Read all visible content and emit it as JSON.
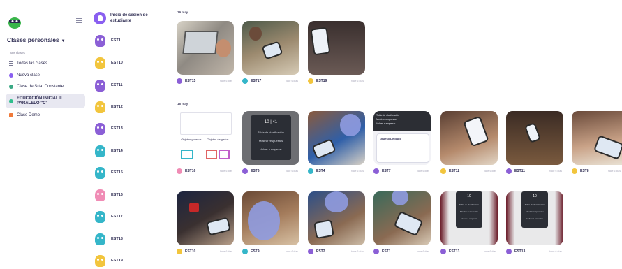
{
  "sidebar": {
    "class_title": "Clases personales",
    "section_label": "Sus clases",
    "items": [
      {
        "label": "Todas las clases",
        "icon": "list-icon",
        "color": "#7b7b95"
      },
      {
        "label": "Nueva clase",
        "icon": "plus-circle-icon",
        "color": "#8a5ff0"
      },
      {
        "label": "Clase de Srta. Constante",
        "icon": "class-dot-icon",
        "color": "#3aa884"
      },
      {
        "label": "EDUCACIÓN INICIAL II PARALELO \"C\"",
        "icon": "class-dot-icon",
        "color": "#2fbf8d"
      },
      {
        "label": "Clase Demo",
        "icon": "demo-icon",
        "color": "#f07a3b"
      }
    ]
  },
  "students": {
    "login_label": "Inicio de sesión de estudiante",
    "list": [
      {
        "name": "EST1",
        "color": "#8b5fd6"
      },
      {
        "name": "EST10",
        "color": "#f2c53d"
      },
      {
        "name": "EST11",
        "color": "#8b5fd6"
      },
      {
        "name": "EST12",
        "color": "#f2c53d"
      },
      {
        "name": "EST13",
        "color": "#8b5fd6"
      },
      {
        "name": "EST14",
        "color": "#35b6c9"
      },
      {
        "name": "EST15",
        "color": "#35b6c9"
      },
      {
        "name": "EST16",
        "color": "#f08cb5"
      },
      {
        "name": "EST17",
        "color": "#35b6c9"
      },
      {
        "name": "EST18",
        "color": "#35b6c9"
      },
      {
        "name": "EST19",
        "color": "#f2c53d"
      }
    ]
  },
  "feed": {
    "date1": "19 may",
    "date2": "18 may",
    "posts_row1": [
      {
        "student": "EST15",
        "time": "hace 6 días"
      },
      {
        "student": "EST17",
        "time": "hace 6 días"
      },
      {
        "student": "EST19",
        "time": "hace 6 días"
      }
    ],
    "posts_row2": [
      {
        "student": "EST16",
        "time": "hace 6 días"
      },
      {
        "student": "EST6",
        "time": "hace 6 días"
      },
      {
        "student": "EST4",
        "time": "hace 6 días"
      },
      {
        "student": "EST7",
        "time": "hace 6 días"
      },
      {
        "student": "EST12",
        "time": "hace 6 días"
      },
      {
        "student": "EST11",
        "time": "hace 6 días"
      },
      {
        "student": "EST8",
        "time": "hace 6 días"
      }
    ],
    "posts_row3": [
      {
        "student": "EST10",
        "time": "hace 6 días"
      },
      {
        "student": "EST9",
        "time": "hace 6 días"
      },
      {
        "student": "EST2",
        "time": "hace 6 días"
      },
      {
        "student": "EST1",
        "time": "hace 6 días"
      },
      {
        "student": "EST13",
        "time": "hace 6 días"
      },
      {
        "student": "EST13",
        "time": "hace 6 días"
      }
    ],
    "card_texts": {
      "objetos_grueso": "Objetos gruesos",
      "objetos_delgado": "Objetos delgados",
      "screen_row1": "Tabla de clasificación",
      "screen_row2": "Mostrar respuestas",
      "screen_row3": "Volver a empezar",
      "group_title": "Grueso Delgado",
      "score1": "10",
      "score2": "41"
    }
  }
}
